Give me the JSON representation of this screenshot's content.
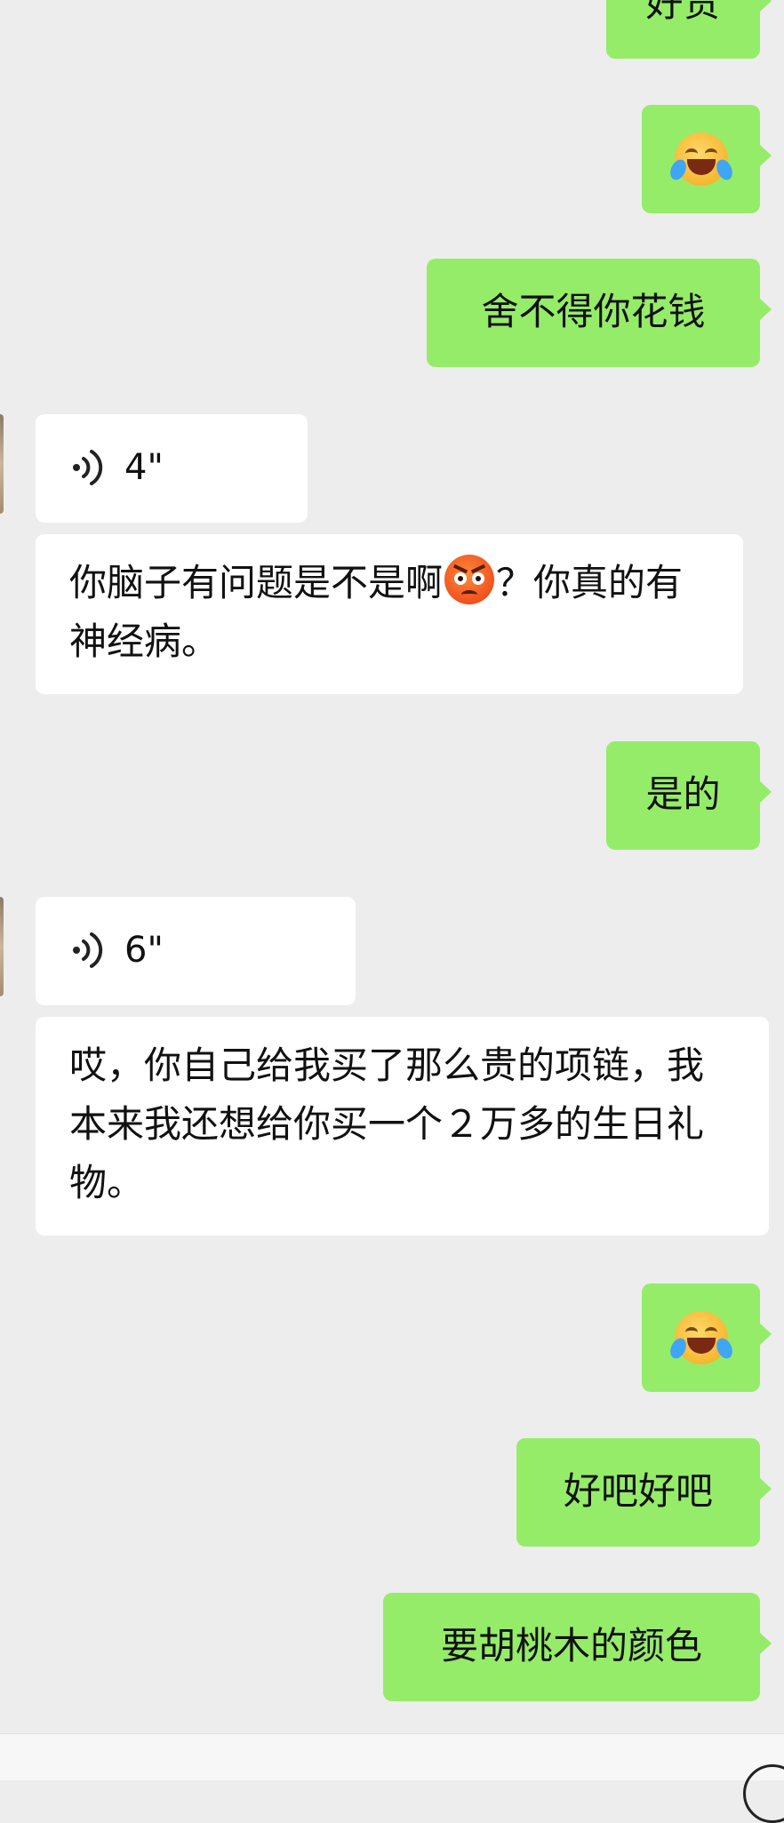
{
  "messages": [
    {
      "side": "me",
      "text": "好贵"
    },
    {
      "side": "me",
      "emoji": "face-with-tears-of-joy"
    },
    {
      "side": "me",
      "text": "舍不得你花钱"
    },
    {
      "side": "them",
      "voice_duration": "4\""
    },
    {
      "side": "them",
      "text_a": "你脑子有问题是不是啊",
      "emoji": "angry-face",
      "text_b": "？你真的有神经病。"
    },
    {
      "side": "me",
      "text": "是的"
    },
    {
      "side": "them",
      "voice_duration": "6\""
    },
    {
      "side": "them",
      "text": "哎，你自己给我买了那么贵的项链，我本来我还想给你买一个２万多的生日礼物。"
    },
    {
      "side": "me",
      "emoji": "face-with-tears-of-joy"
    },
    {
      "side": "me",
      "text": "好吧好吧"
    },
    {
      "side": "me",
      "text": "要胡桃木的颜色"
    }
  ],
  "colors": {
    "background": "#ededed",
    "my_bubble": "#95ec69",
    "their_bubble": "#ffffff"
  }
}
